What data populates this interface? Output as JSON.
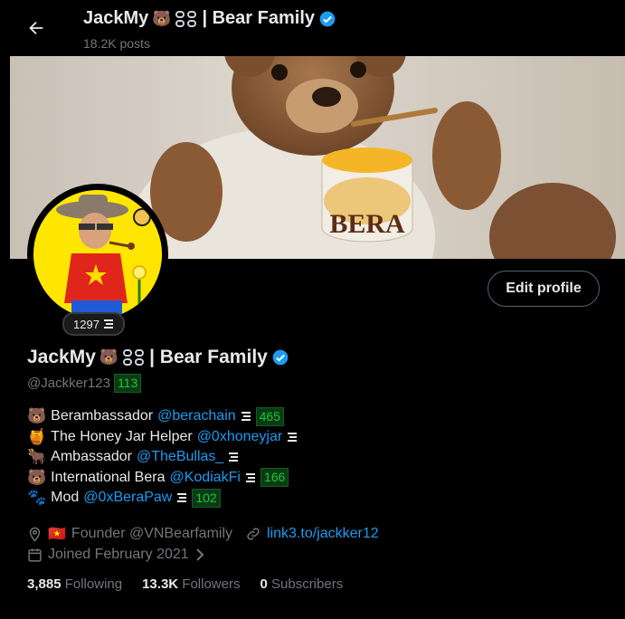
{
  "header": {
    "back_icon": "arrow-left-icon",
    "title_name": "JackMy",
    "title_emoji": "🐻",
    "title_suffix": "| Bear Family",
    "posts": "18.2K posts"
  },
  "banner": {
    "label": "BERA"
  },
  "avatar": {
    "badge_count": "1297"
  },
  "edit_button": "Edit profile",
  "profile": {
    "name": "JackMy",
    "name_emoji": "🐻",
    "name_suffix": "| Bear Family",
    "handle": "@Jackker123",
    "handle_badge": "113"
  },
  "bio": [
    {
      "emoji": "🐻",
      "text": "Berambassador",
      "link": "@berachain",
      "badge": "465"
    },
    {
      "emoji": "🍯",
      "text": "The Honey Jar Helper",
      "link": "@0xhoneyjar",
      "badge": ""
    },
    {
      "emoji": "🐂",
      "text": "Ambassador",
      "link": "@TheBullas_",
      "badge": ""
    },
    {
      "emoji": "🐻",
      "text": "International Bera",
      "link": "@KodiakFi",
      "badge": "166"
    },
    {
      "emoji": "🐾",
      "text": "Mod",
      "link": "@0xBeraPaw",
      "badge": "102"
    }
  ],
  "meta": {
    "location_flag": "🇻🇳",
    "location": "Founder @VNBearfamily",
    "website": "link3.to/jackker12",
    "joined": "Joined February 2021"
  },
  "stats": {
    "following_count": "3,885",
    "following_label": "Following",
    "followers_count": "13.3K",
    "followers_label": "Followers",
    "subscribers_count": "0",
    "subscribers_label": "Subscribers"
  },
  "colors": {
    "accent": "#1d9bf0",
    "badge_green": "#19c936",
    "background": "#000000",
    "muted": "#71767b"
  }
}
